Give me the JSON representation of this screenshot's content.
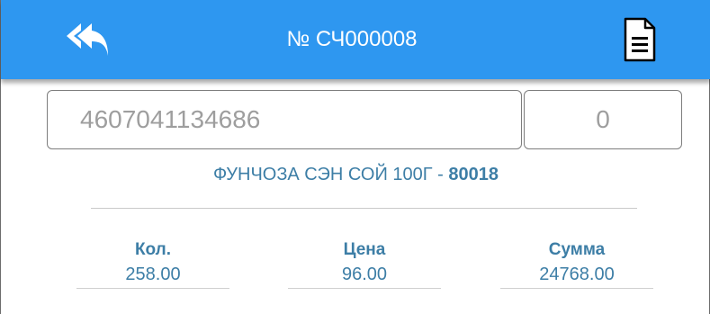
{
  "colors": {
    "accent": "#2e97f0",
    "text": "#3d7ea6",
    "border": "#7d7d7d"
  },
  "header": {
    "title": "№ СЧ000008",
    "back_icon": "reply-all-icon",
    "document_icon": "document-icon"
  },
  "scan": {
    "barcode_placeholder": "4607041134686",
    "quantity_placeholder": "0"
  },
  "product": {
    "name": "ФУНЧОЗА СЭН СОЙ 100Г - ",
    "code": "80018"
  },
  "fields": {
    "qty_label": "Кол.",
    "qty_value": "258.00",
    "price_label": "Цена",
    "price_value": "96.00",
    "sum_label": "Сумма",
    "sum_value": "24768.00"
  }
}
